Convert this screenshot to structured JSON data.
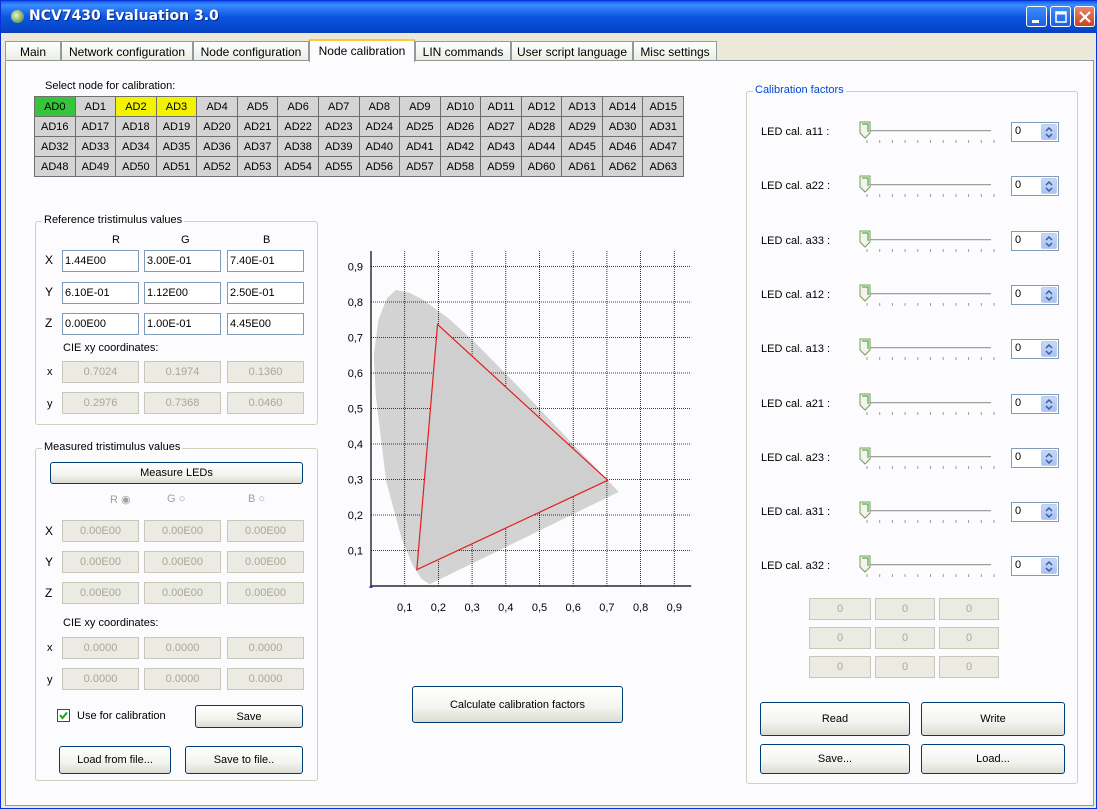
{
  "window": {
    "title": "NCV7430 Evaluation 3.0"
  },
  "tabs": [
    "Main",
    "Network configuration",
    "Node configuration",
    "Node calibration",
    "LIN commands",
    "User script language",
    "Misc settings"
  ],
  "node_select": {
    "label": "Select node for calibration:",
    "nodes": [
      "AD0",
      "AD1",
      "AD2",
      "AD3",
      "AD4",
      "AD5",
      "AD6",
      "AD7",
      "AD8",
      "AD9",
      "AD10",
      "AD11",
      "AD12",
      "AD13",
      "AD14",
      "AD15",
      "AD16",
      "AD17",
      "AD18",
      "AD19",
      "AD20",
      "AD21",
      "AD22",
      "AD23",
      "AD24",
      "AD25",
      "AD26",
      "AD27",
      "AD28",
      "AD29",
      "AD30",
      "AD31",
      "AD32",
      "AD33",
      "AD34",
      "AD35",
      "AD36",
      "AD37",
      "AD38",
      "AD39",
      "AD40",
      "AD41",
      "AD42",
      "AD43",
      "AD44",
      "AD45",
      "AD46",
      "AD47",
      "AD48",
      "AD49",
      "AD50",
      "AD51",
      "AD52",
      "AD53",
      "AD54",
      "AD55",
      "AD56",
      "AD57",
      "AD58",
      "AD59",
      "AD60",
      "AD61",
      "AD62",
      "AD63"
    ],
    "selected": "AD0",
    "calibrated": [
      "AD2",
      "AD3"
    ],
    "colors": {
      "selected": "#35c43a",
      "calibrated": "#f3f300",
      "default": "#d4d4d4"
    }
  },
  "reference": {
    "title": "Reference tristimulus values",
    "cols": [
      "R",
      "G",
      "B"
    ],
    "rows": [
      {
        "label": "X",
        "values": [
          "1.44E00",
          "3.00E-01",
          "7.40E-01"
        ]
      },
      {
        "label": "Y",
        "values": [
          "6.10E-01",
          "1.12E00",
          "2.50E-01"
        ]
      },
      {
        "label": "Z",
        "values": [
          "0.00E00",
          "1.00E-01",
          "4.45E00"
        ]
      }
    ],
    "cie_label": "CIE xy coordinates:",
    "cie": [
      {
        "label": "x",
        "values": [
          "0.7024",
          "0.1974",
          "0.1360"
        ]
      },
      {
        "label": "y",
        "values": [
          "0.2976",
          "0.7368",
          "0.0460"
        ]
      }
    ]
  },
  "measured": {
    "title": "Measured tristimulus values",
    "measure_button": "Measure LEDs",
    "radios": [
      "R",
      "G",
      "B"
    ],
    "rows": [
      {
        "label": "X",
        "values": [
          "0.00E00",
          "0.00E00",
          "0.00E00"
        ]
      },
      {
        "label": "Y",
        "values": [
          "0.00E00",
          "0.00E00",
          "0.00E00"
        ]
      },
      {
        "label": "Z",
        "values": [
          "0.00E00",
          "0.00E00",
          "0.00E00"
        ]
      }
    ],
    "cie_label": "CIE xy coordinates:",
    "cie": [
      {
        "label": "x",
        "values": [
          "0.0000",
          "0.0000",
          "0.0000"
        ]
      },
      {
        "label": "y",
        "values": [
          "0.0000",
          "0.0000",
          "0.0000"
        ]
      }
    ],
    "use_for_calibration": "Use for calibration",
    "use_checked": true,
    "save": "Save",
    "load_from_file": "Load from file...",
    "save_to_file": "Save to file.."
  },
  "chart_data": {
    "type": "scatter",
    "title": "",
    "xlabel": "",
    "ylabel": "",
    "xlim": [
      0,
      0.95
    ],
    "ylim": [
      0,
      0.95
    ],
    "x_ticks": [
      "0,1",
      "0,2",
      "0,3",
      "0,4",
      "0,5",
      "0,6",
      "0,7",
      "0,8",
      "0,9"
    ],
    "y_ticks": [
      "0,1",
      "0,2",
      "0,3",
      "0,4",
      "0,5",
      "0,6",
      "0,7",
      "0,8",
      "0,9"
    ],
    "grid": true,
    "gamut_triangle": {
      "x": [
        0.7024,
        0.1974,
        0.136
      ],
      "y": [
        0.2976,
        0.7368,
        0.046
      ],
      "color": "#e02020"
    },
    "spectral_locus_color": "#d3d3d3"
  },
  "calculate_button": "Calculate calibration factors",
  "calibration": {
    "title": "Calibration factors",
    "factors": [
      {
        "label": "LED cal. a11 :",
        "value": "0"
      },
      {
        "label": "LED cal. a22 :",
        "value": "0"
      },
      {
        "label": "LED cal. a33 :",
        "value": "0"
      },
      {
        "label": "LED cal. a12 :",
        "value": "0"
      },
      {
        "label": "LED cal. a13 :",
        "value": "0"
      },
      {
        "label": "LED cal. a21 :",
        "value": "0"
      },
      {
        "label": "LED cal. a23 :",
        "value": "0"
      },
      {
        "label": "LED cal. a31 :",
        "value": "0"
      },
      {
        "label": "LED cal. a32 :",
        "value": "0"
      }
    ],
    "matrix": [
      [
        "0",
        "0",
        "0"
      ],
      [
        "0",
        "0",
        "0"
      ],
      [
        "0",
        "0",
        "0"
      ]
    ],
    "read": "Read",
    "write": "Write",
    "save": "Save...",
    "load": "Load..."
  }
}
